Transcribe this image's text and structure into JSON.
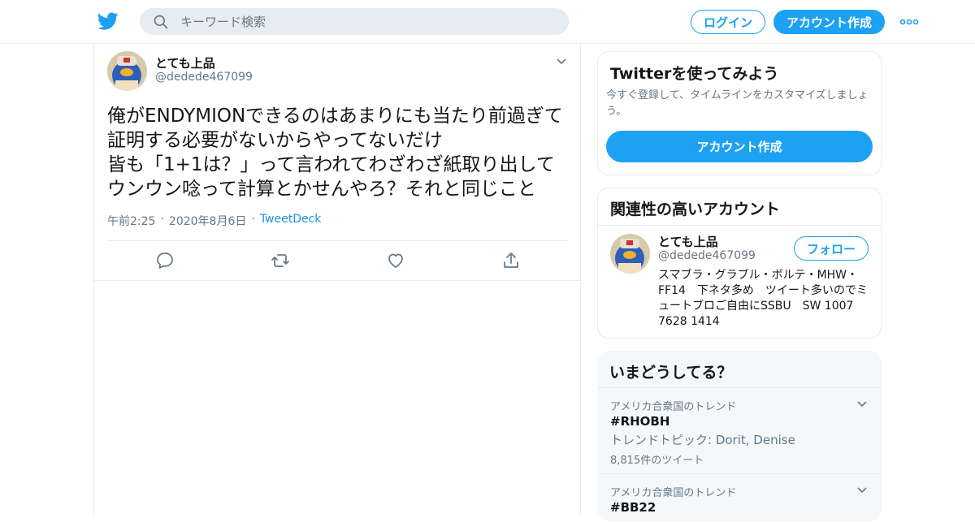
{
  "header": {
    "search_placeholder": "キーワード検索",
    "login_label": "ログイン",
    "signup_label": "アカウント作成",
    "more_icon": "more-dots-icon",
    "logo_icon": "twitter-bird-icon",
    "accent_color": "#1da1f2"
  },
  "tweet": {
    "author_name": "とても上品",
    "author_handle": "@dedede467099",
    "text": "俺がENDYMIONできるのはあまりにも当たり前過ぎて証明する必要がないからやってないだけ\n皆も「1+1は？」って言われてわざわざ紙取り出してウンウン唸って計算とかせんやろ？それと同じこと",
    "time": "午前2:25",
    "date": "2020年8月6日",
    "source": "TweetDeck",
    "actions": [
      "reply-icon",
      "retweet-icon",
      "like-icon",
      "share-icon"
    ]
  },
  "sidebar": {
    "signup_card": {
      "title": "Twitterを使ってみよう",
      "description": "今すぐ登録して、タイムラインをカスタマイズしましょう。",
      "button_label": "アカウント作成"
    },
    "related": {
      "title": "関連性の高いアカウント",
      "name": "とても上品",
      "handle": "@dedede467099",
      "follow_label": "フォロー",
      "bio": "スマブラ・グラブル・ボルテ・MHW・FF14　下ネタ多め　ツイート多いのでミュートブロご自由にSSBU　SW 1007 7628 1414"
    },
    "trends": {
      "title": "いまどうしてる？",
      "items": [
        {
          "location": "アメリカ合衆国のトレンド",
          "tag": "#RHOBH",
          "topic": "トレンドトピック: Dorit, Denise",
          "count": "8,815件のツイート"
        },
        {
          "location": "アメリカ合衆国のトレンド",
          "tag": "#BB22"
        }
      ]
    }
  }
}
